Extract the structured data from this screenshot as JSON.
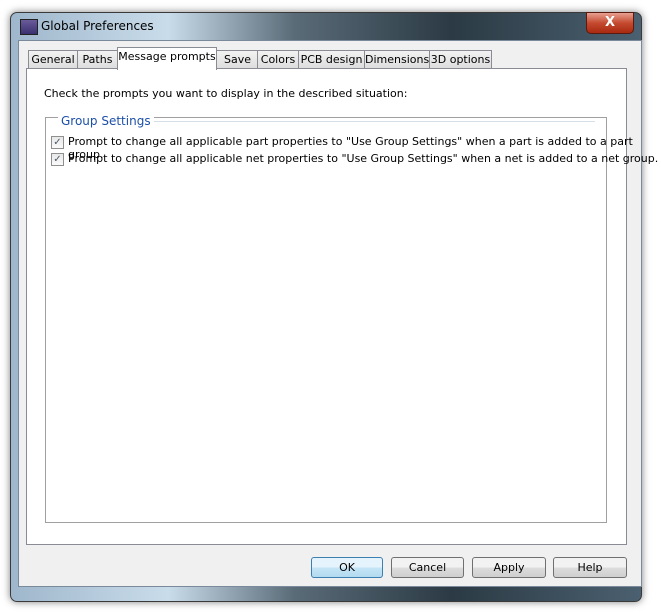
{
  "window": {
    "title": "Global Preferences",
    "close_label": "X"
  },
  "tabs": [
    {
      "label": "General"
    },
    {
      "label": "Paths"
    },
    {
      "label": "Message prompts",
      "active": true
    },
    {
      "label": "Save"
    },
    {
      "label": "Colors"
    },
    {
      "label": "PCB design"
    },
    {
      "label": "Dimensions"
    },
    {
      "label": "3D options"
    }
  ],
  "content": {
    "intro": "Check the prompts you want to display in the described situation:",
    "group_title": "Group Settings",
    "options": [
      {
        "label": "Prompt to change all applicable part properties to \"Use Group Settings\" when a part is added to a part group.",
        "checked": true
      },
      {
        "label": "Prompt to change all applicable net properties to \"Use Group Settings\" when a net is added to a net group.",
        "checked": true
      }
    ]
  },
  "buttons": {
    "ok": "OK",
    "cancel": "Cancel",
    "apply": "Apply",
    "help": "Help"
  },
  "checkmark": "✓"
}
